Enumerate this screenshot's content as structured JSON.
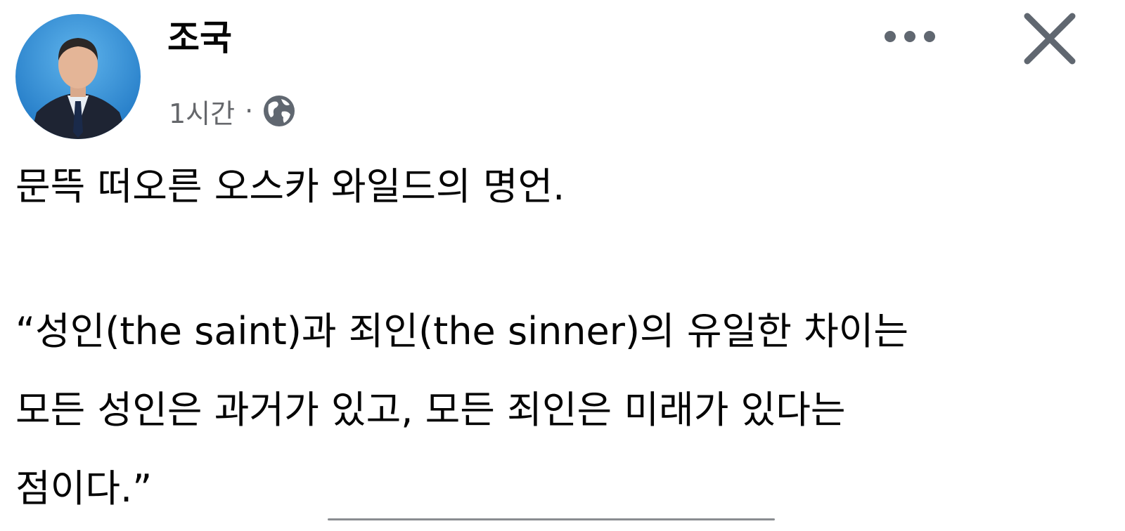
{
  "post": {
    "author": "조국",
    "timestamp": "1시간",
    "separator": "·",
    "privacy_icon": "globe-icon",
    "more_icon": "more-dots-icon",
    "close_icon": "close-icon",
    "text": {
      "intro": "문뜩 떠오른 오스카 와일드의 명언.",
      "quote_lines": [
        "“성인(the saint)과 죄인(the sinner)의 유일한 차이는",
        "모든 성인은 과거가 있고, 모든 죄인은 미래가 있다는",
        "점이다.”"
      ]
    }
  },
  "colors": {
    "avatar_background": "#2f8fd6",
    "text_primary": "#050505",
    "text_secondary": "#65676b",
    "icon_gray": "#606770"
  }
}
